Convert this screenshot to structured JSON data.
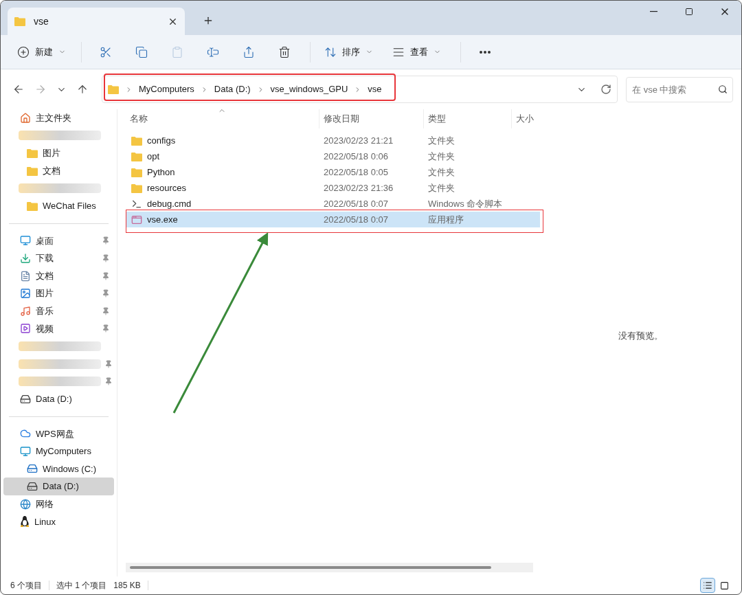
{
  "tab": {
    "title": "vse"
  },
  "toolbar": [
    {
      "kind": "new",
      "label": "新建",
      "disabled": false
    },
    {
      "kind": "cut",
      "disabled": false
    },
    {
      "kind": "copy",
      "disabled": false
    },
    {
      "kind": "paste",
      "disabled": true
    },
    {
      "kind": "rename",
      "disabled": false
    },
    {
      "kind": "share",
      "disabled": false
    },
    {
      "kind": "delete",
      "disabled": false
    },
    {
      "kind": "sort",
      "label": "排序",
      "disabled": false
    },
    {
      "kind": "view",
      "label": "查看",
      "disabled": false
    },
    {
      "kind": "more",
      "disabled": false
    }
  ],
  "breadcrumb": [
    "MyComputers",
    "Data (D:)",
    "vse_windows_GPU",
    "vse"
  ],
  "search": {
    "placeholder": "在 vse 中搜索"
  },
  "sidebar": [
    {
      "kind": "home",
      "label": "主文件夹",
      "selected": false,
      "pinned": false
    },
    {
      "kind": "redacted",
      "pinned": false,
      "children": [
        {
          "kind": "folder",
          "label": "图片",
          "selected": false,
          "pinned": false
        },
        {
          "kind": "folder",
          "label": "文档",
          "selected": false,
          "pinned": false
        }
      ]
    },
    {
      "kind": "redacted",
      "pinned": false,
      "children": [
        {
          "kind": "folder",
          "label": "WeChat Files",
          "selected": false,
          "pinned": false
        }
      ]
    },
    {
      "kind": "divider"
    },
    {
      "kind": "desktop",
      "label": "桌面",
      "selected": false,
      "pinned": true
    },
    {
      "kind": "download",
      "label": "下载",
      "selected": false,
      "pinned": true
    },
    {
      "kind": "documents",
      "label": "文档",
      "selected": false,
      "pinned": true
    },
    {
      "kind": "pictures",
      "label": "图片",
      "selected": false,
      "pinned": true
    },
    {
      "kind": "music",
      "label": "音乐",
      "selected": false,
      "pinned": true
    },
    {
      "kind": "video",
      "label": "视频",
      "selected": false,
      "pinned": true
    },
    {
      "kind": "redacted",
      "pinned": false
    },
    {
      "kind": "redacted",
      "pinned": true
    },
    {
      "kind": "redacted",
      "pinned": true
    },
    {
      "kind": "drive",
      "label": "Data (D:)",
      "selected": false,
      "pinned": false
    },
    {
      "kind": "divider"
    },
    {
      "kind": "cloud",
      "label": "WPS网盘",
      "selected": false,
      "pinned": false
    },
    {
      "kind": "computer",
      "label": "MyComputers",
      "selected": false,
      "pinned": false,
      "children": [
        {
          "kind": "windrive",
          "label": "Windows (C:)",
          "selected": false,
          "pinned": false
        },
        {
          "kind": "drive",
          "label": "Data (D:)",
          "selected": true,
          "pinned": false
        }
      ]
    },
    {
      "kind": "network",
      "label": "网络",
      "selected": false,
      "pinned": false
    },
    {
      "kind": "linux",
      "label": "Linux",
      "selected": false,
      "pinned": false
    }
  ],
  "table": {
    "columns": [
      "名称",
      "修改日期",
      "类型",
      "大小"
    ],
    "rows": [
      {
        "kind": "folder",
        "name": "configs",
        "date": "2023/02/23 21:21",
        "type": "文件夹",
        "selected": false
      },
      {
        "kind": "folder",
        "name": "opt",
        "date": "2022/05/18 0:06",
        "type": "文件夹",
        "selected": false
      },
      {
        "kind": "folder",
        "name": "Python",
        "date": "2022/05/18 0:05",
        "type": "文件夹",
        "selected": false
      },
      {
        "kind": "folder",
        "name": "resources",
        "date": "2023/02/23 21:36",
        "type": "文件夹",
        "selected": false
      },
      {
        "kind": "script",
        "name": "debug.cmd",
        "date": "2022/05/18 0:07",
        "type": "Windows 命令脚本",
        "selected": false
      },
      {
        "kind": "app",
        "name": "vse.exe",
        "date": "2022/05/18 0:07",
        "type": "应用程序",
        "selected": true
      }
    ]
  },
  "preview": {
    "message": "没有预览。"
  },
  "status_bar": {
    "count": "6 个项目",
    "selection": "选中 1 个项目",
    "size": "185 KB"
  },
  "view_buttons": [
    {
      "kind": "details",
      "selected": true
    },
    {
      "kind": "tiles",
      "selected": false
    }
  ]
}
